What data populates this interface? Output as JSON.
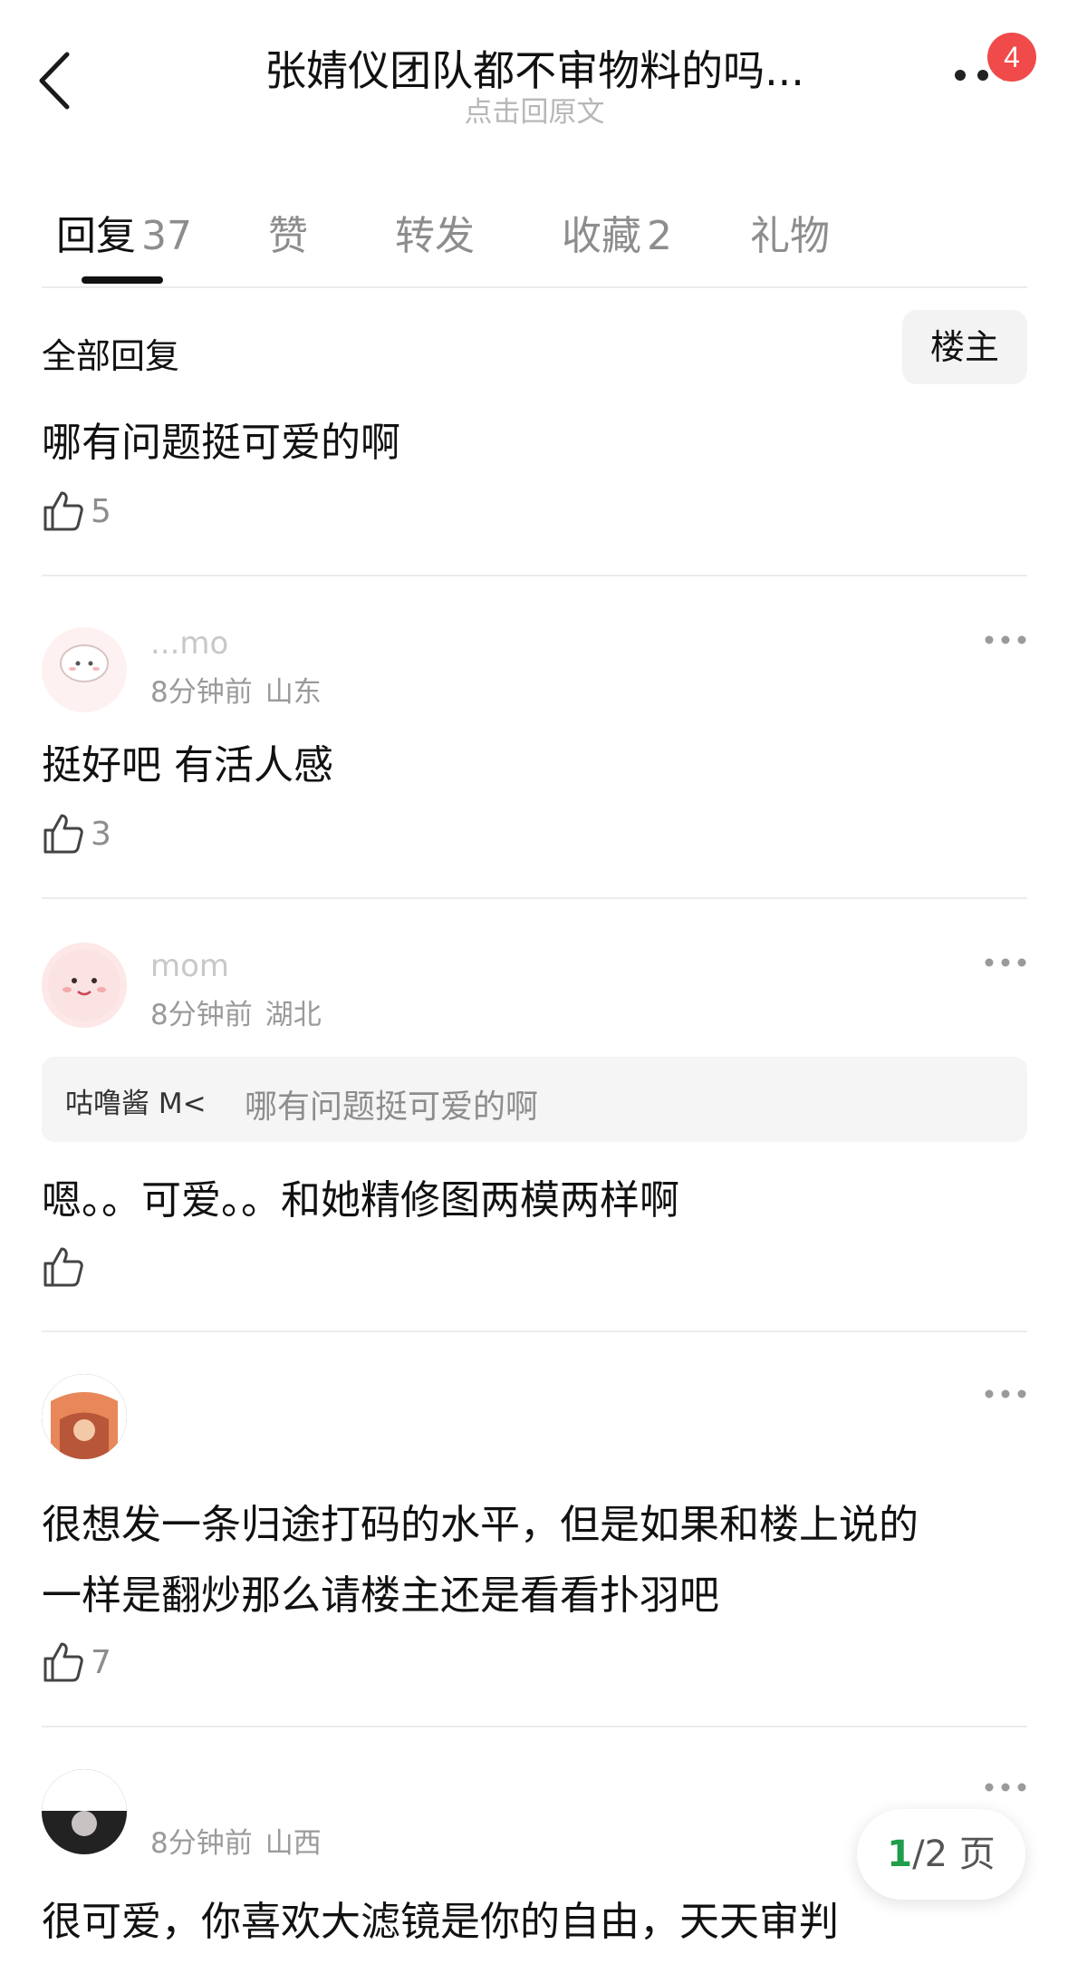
{
  "header": {
    "title": "张婧仪团队都不审物料的吗...",
    "subtitle": "点击回原文",
    "badge": "4"
  },
  "tabs": [
    {
      "label": "回复",
      "count": "37"
    },
    {
      "label": "赞"
    },
    {
      "label": "转发"
    },
    {
      "label": "收藏",
      "count": "2"
    },
    {
      "label": "礼物"
    }
  ],
  "filter": {
    "all_replies": "全部回复",
    "op_only": "楼主"
  },
  "comments": [
    {
      "text": "哪有问题挺可爱的啊",
      "likes": "5"
    },
    {
      "username": "...mo",
      "time": "8分钟前",
      "location": "山东",
      "text": "挺好吧 有活人感",
      "likes": "3"
    },
    {
      "username": "mom",
      "time": "8分钟前",
      "location": "湖北",
      "quote_name": "咕噜酱 M<",
      "quote_text": "哪有问题挺可爱的啊",
      "text": "嗯。。可爱。。和她精修图两模两样啊",
      "likes": ""
    },
    {
      "line1": "很想发一条归途打码的水平，但是如果和楼上说的",
      "line2": "一样是翻炒那么请楼主还是看看扑羽吧",
      "likes": "7"
    },
    {
      "time": "8分钟前",
      "location": "山西",
      "text": "很可爱，你喜欢大滤镜是你的自由，天天审判"
    }
  ],
  "pagination": {
    "current": "1",
    "total": "/2 页"
  },
  "icons": [
    "back-arrow-icon",
    "more-dots-icon",
    "thumbs-up-icon"
  ],
  "colors": {
    "badge": "#f04a4a",
    "page_current": "#1f9d4b"
  }
}
